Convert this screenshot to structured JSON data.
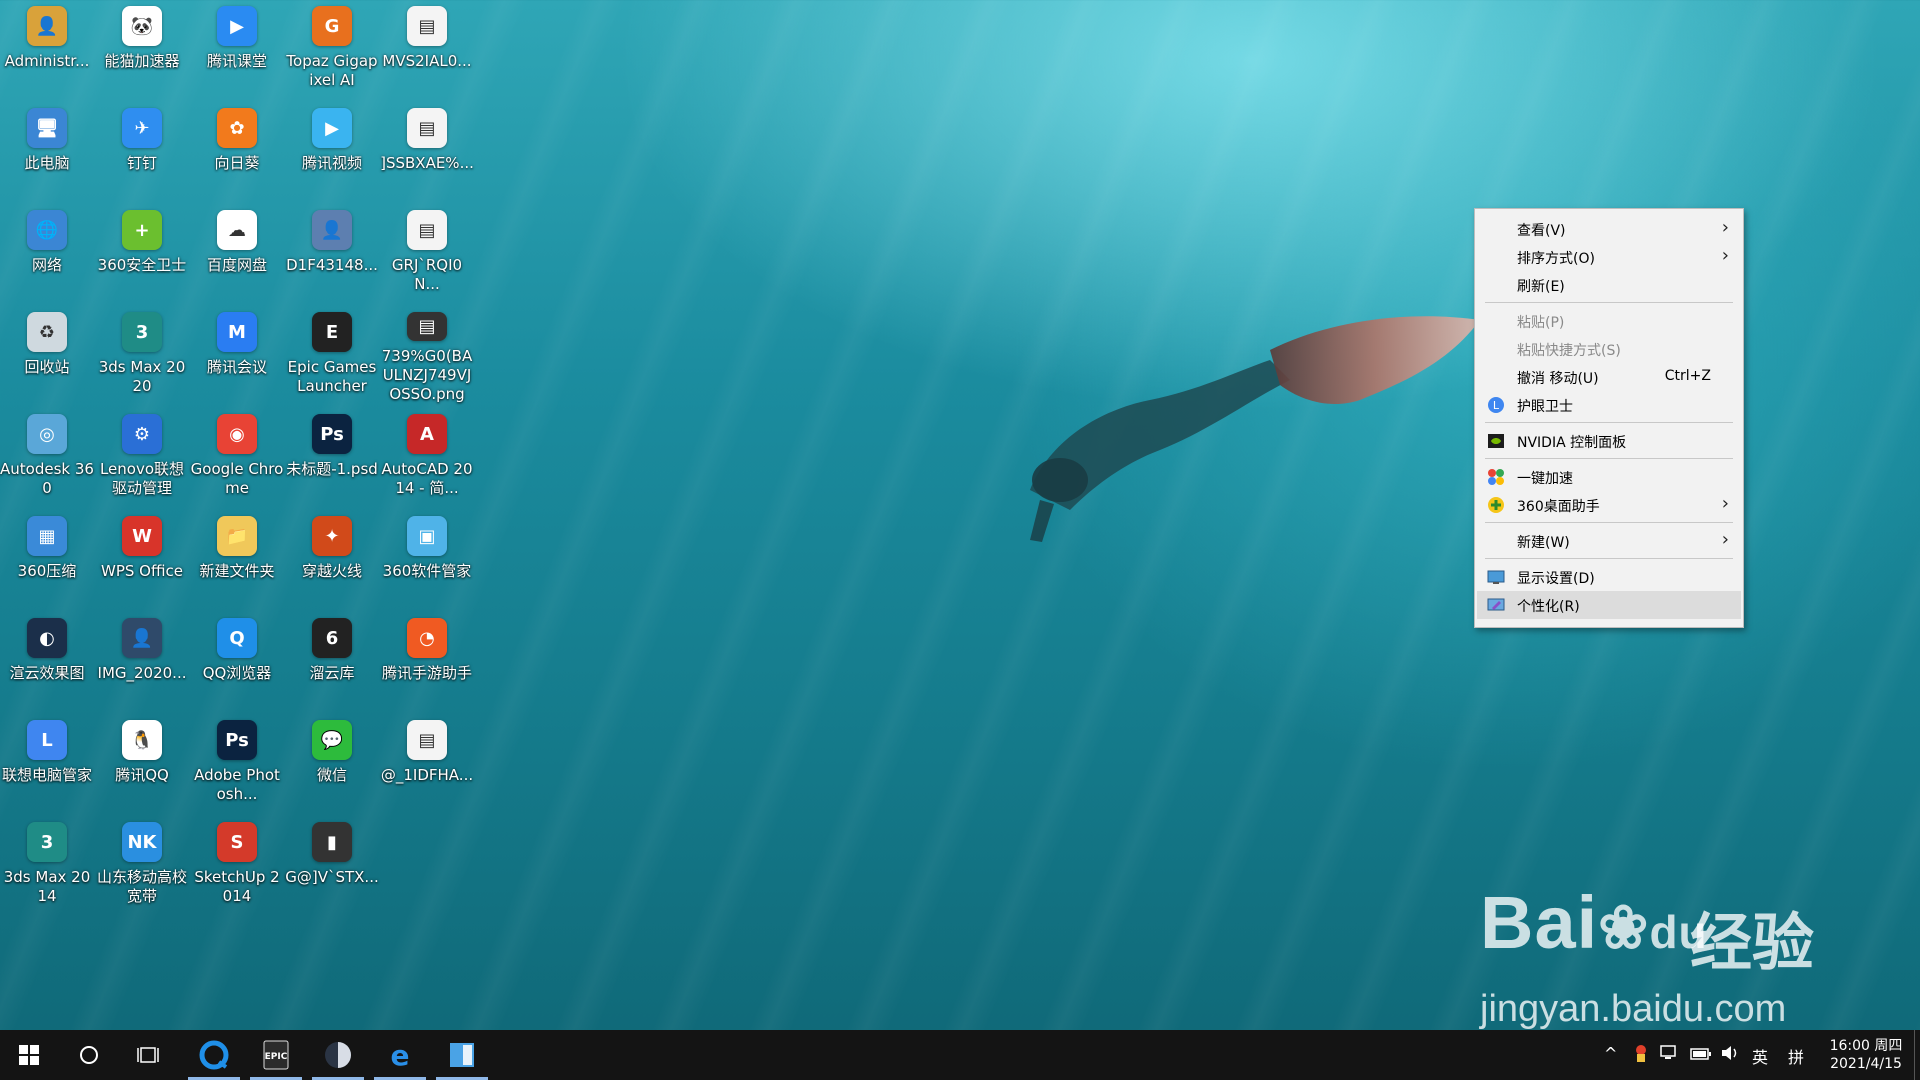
{
  "desktop": {
    "icons": [
      {
        "label": "Administr...",
        "color": "#d9a23a",
        "glyph": "👤"
      },
      {
        "label": "能猫加速器",
        "color": "#ffffff",
        "glyph": "🐼"
      },
      {
        "label": "腾讯课堂",
        "color": "#2a8bf2",
        "glyph": "▶"
      },
      {
        "label": "Topaz Gigapixel AI",
        "color": "#e8701e",
        "glyph": "G"
      },
      {
        "label": "MVS2IAL0...",
        "color": "#f4f4f4",
        "glyph": "▤"
      },
      {
        "label": "此电脑",
        "color": "#3b86d4",
        "glyph": "🖥"
      },
      {
        "label": "钉钉",
        "color": "#2f8ef0",
        "glyph": "✈"
      },
      {
        "label": "向日葵",
        "color": "#f27a1c",
        "glyph": "✿"
      },
      {
        "label": "腾讯视频",
        "color": "#3ab4f0",
        "glyph": "▶"
      },
      {
        "label": "]SSBXAE%...",
        "color": "#f4f4f4",
        "glyph": "▤"
      },
      {
        "label": "网络",
        "color": "#3b86d4",
        "glyph": "🌐"
      },
      {
        "label": "360安全卫士",
        "color": "#6bbf2f",
        "glyph": "+"
      },
      {
        "label": "百度网盘",
        "color": "#ffffff",
        "glyph": "☁"
      },
      {
        "label": "D1F43148...",
        "color": "#5d7fb0",
        "glyph": "👤"
      },
      {
        "label": "GRJ`RQI0N...",
        "color": "#f4f4f4",
        "glyph": "▤"
      },
      {
        "label": "回收站",
        "color": "#cfd9df",
        "glyph": "♻"
      },
      {
        "label": "3ds Max 2020",
        "color": "#1f8c86",
        "glyph": "3"
      },
      {
        "label": "腾讯会议",
        "color": "#2a7df2",
        "glyph": "M"
      },
      {
        "label": "Epic Games Launcher",
        "color": "#222222",
        "glyph": "E"
      },
      {
        "label": "739%G0(BA ULNZJ749VJ OSSO.png",
        "color": "#333333",
        "glyph": "▤"
      },
      {
        "label": "Autodesk 360",
        "color": "#5aa7d8",
        "glyph": "◎"
      },
      {
        "label": "Lenovo联想驱动管理",
        "color": "#2a6fd6",
        "glyph": "⚙"
      },
      {
        "label": "Google Chrome",
        "color": "#e84335",
        "glyph": "◉"
      },
      {
        "label": "未标题-1.psd",
        "color": "#0b2340",
        "glyph": "Ps"
      },
      {
        "label": "AutoCAD 2014 - 简...",
        "color": "#c62828",
        "glyph": "A"
      },
      {
        "label": "360压缩",
        "color": "#3a8ad8",
        "glyph": "▦"
      },
      {
        "label": "WPS Office",
        "color": "#d8342a",
        "glyph": "W"
      },
      {
        "label": "新建文件夹",
        "color": "#f0c85a",
        "glyph": "📁"
      },
      {
        "label": "穿越火线",
        "color": "#d14a1a",
        "glyph": "✦"
      },
      {
        "label": "360软件管家",
        "color": "#4fb3e8",
        "glyph": "▣"
      },
      {
        "label": "渲云效果图",
        "color": "#1b2f4a",
        "glyph": "◐"
      },
      {
        "label": "IMG_2020...",
        "color": "#2f4a6a",
        "glyph": "👤"
      },
      {
        "label": "QQ浏览器",
        "color": "#1f8fe8",
        "glyph": "Q"
      },
      {
        "label": "溜云库",
        "color": "#222222",
        "glyph": "6"
      },
      {
        "label": "腾讯手游助手",
        "color": "#f05a22",
        "glyph": "◔"
      },
      {
        "label": "联想电脑管家",
        "color": "#3f86f0",
        "glyph": "L"
      },
      {
        "label": "腾讯QQ",
        "color": "#ffffff",
        "glyph": "🐧"
      },
      {
        "label": "Adobe Photosh...",
        "color": "#0b2340",
        "glyph": "Ps"
      },
      {
        "label": "微信",
        "color": "#2dbb3c",
        "glyph": "💬"
      },
      {
        "label": "@_1IDFHA...",
        "color": "#f4f4f4",
        "glyph": "▤"
      },
      {
        "label": "3ds Max 2014",
        "color": "#1f8c86",
        "glyph": "3"
      },
      {
        "label": "山东移动高校宽带",
        "color": "#2a8fe0",
        "glyph": "NK"
      },
      {
        "label": "SketchUp 2014",
        "color": "#d43a2a",
        "glyph": "S"
      },
      {
        "label": "G@]V`STX...",
        "color": "#333333",
        "glyph": "▮"
      }
    ]
  },
  "context_menu": {
    "items": [
      {
        "label": "查看(V)",
        "shortcut": "",
        "arrow": "›",
        "disabled": false,
        "icon": ""
      },
      {
        "label": "排序方式(O)",
        "shortcut": "",
        "arrow": "›",
        "disabled": false,
        "icon": ""
      },
      {
        "label": "刷新(E)",
        "shortcut": "",
        "arrow": "",
        "disabled": false,
        "icon": ""
      },
      {
        "label": "粘贴(P)",
        "shortcut": "",
        "arrow": "",
        "disabled": true,
        "icon": ""
      },
      {
        "label": "粘贴快捷方式(S)",
        "shortcut": "",
        "arrow": "",
        "disabled": true,
        "icon": ""
      },
      {
        "label": "撤消 移动(U)",
        "shortcut": "Ctrl+Z",
        "arrow": "",
        "disabled": false,
        "icon": ""
      },
      {
        "label": "护眼卫士",
        "shortcut": "",
        "arrow": "",
        "disabled": false,
        "icon": "eye-guard-icon"
      },
      {
        "label": "NVIDIA 控制面板",
        "shortcut": "",
        "arrow": "",
        "disabled": false,
        "icon": "nvidia-icon"
      },
      {
        "label": "一键加速",
        "shortcut": "",
        "arrow": "",
        "disabled": false,
        "icon": "speedup-icon"
      },
      {
        "label": "360桌面助手",
        "shortcut": "",
        "arrow": "›",
        "disabled": false,
        "icon": "360-assistant-icon"
      },
      {
        "label": "新建(W)",
        "shortcut": "",
        "arrow": "›",
        "disabled": false,
        "icon": ""
      },
      {
        "label": "显示设置(D)",
        "shortcut": "",
        "arrow": "",
        "disabled": false,
        "icon": "display-settings-icon"
      },
      {
        "label": "个性化(R)",
        "shortcut": "",
        "arrow": "",
        "disabled": false,
        "icon": "personalize-icon"
      }
    ]
  },
  "watermark": {
    "brand": "Bai",
    "brand2": "du",
    "cn": "经验",
    "url": "jingyan.baidu.com"
  },
  "taskbar": {
    "tray": {
      "chevron": "^",
      "ime": "英",
      "keyboard": "拼"
    },
    "clock": {
      "time": "16:00 周四",
      "date": "2021/4/15"
    },
    "apps": [
      "QQ浏览器",
      "Epic Games",
      "渲云效果图",
      "Edge",
      "Explorer"
    ]
  },
  "colors": {
    "taskbar": "#141414",
    "menu_bg": "#f2f2f2",
    "menu_highlight": "#dcdcdc",
    "disabled_text": "#8a8a8a"
  }
}
